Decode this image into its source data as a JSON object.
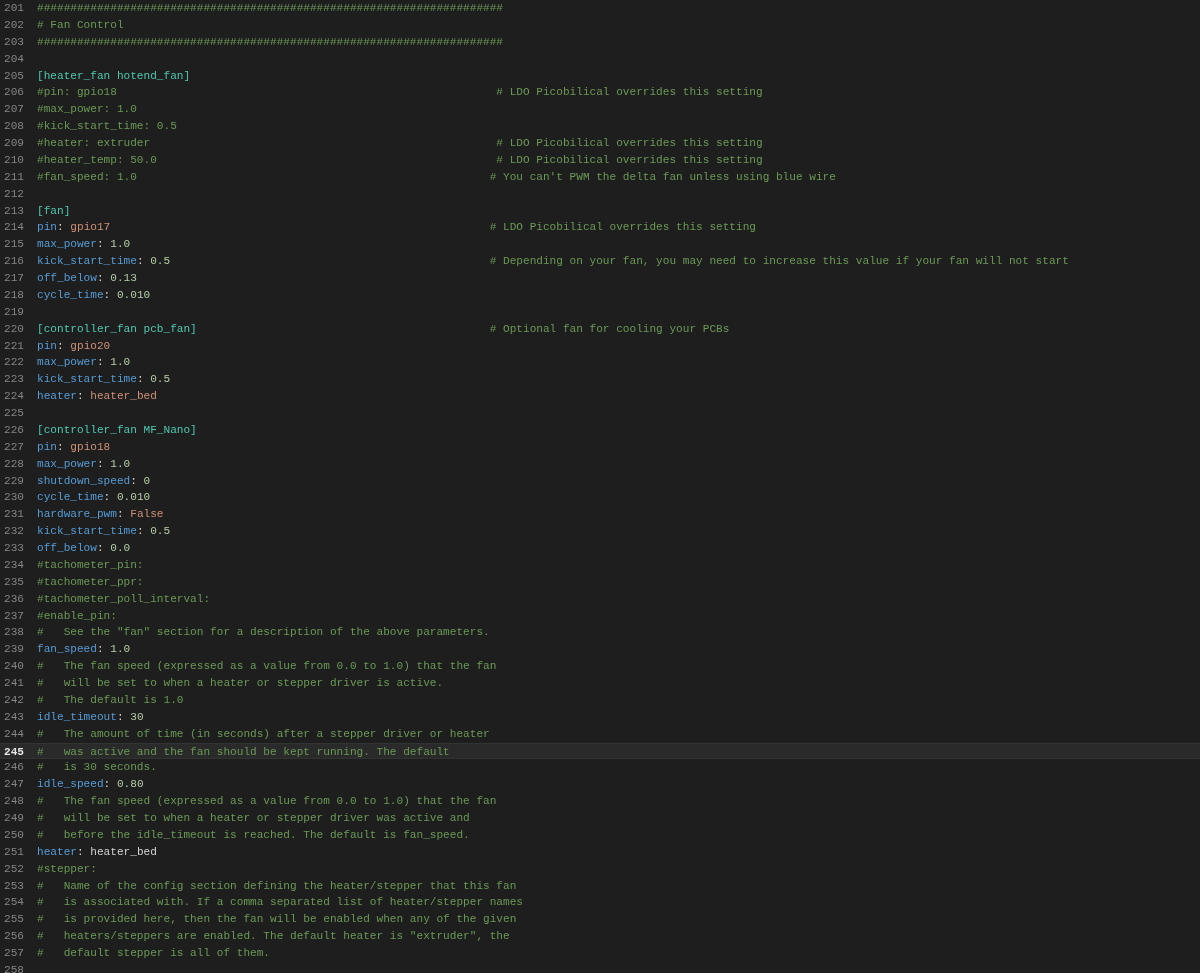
{
  "editor": {
    "lines": [
      {
        "number": "201",
        "current": false,
        "tokens": [
          {
            "kind": "comment",
            "text": "######################################################################"
          }
        ]
      },
      {
        "number": "202",
        "current": false,
        "tokens": [
          {
            "kind": "comment",
            "text": "# Fan Control"
          }
        ]
      },
      {
        "number": "203",
        "current": false,
        "tokens": [
          {
            "kind": "comment",
            "text": "######################################################################"
          }
        ]
      },
      {
        "number": "204",
        "current": false
      },
      {
        "number": "205",
        "current": false,
        "tokens": [
          {
            "kind": "section",
            "text": "[heater_fan hotend_fan]"
          }
        ]
      },
      {
        "number": "206",
        "current": false,
        "tokens": [
          {
            "kind": "comment",
            "text": "#pin: gpio18"
          },
          {
            "kind": "trailing_comment",
            "text": " # LDO Picobilical overrides this setting"
          }
        ]
      },
      {
        "number": "207",
        "current": false,
        "tokens": [
          {
            "kind": "comment",
            "text": "#max_power: 1.0"
          }
        ]
      },
      {
        "number": "208",
        "current": false,
        "tokens": [
          {
            "kind": "comment",
            "text": "#kick_start_time: 0.5"
          }
        ]
      },
      {
        "number": "209",
        "current": false,
        "tokens": [
          {
            "kind": "comment",
            "text": "#heater: extruder"
          },
          {
            "kind": "trailing_comment",
            "text": " # LDO Picobilical overrides this setting"
          }
        ]
      },
      {
        "number": "210",
        "current": false,
        "tokens": [
          {
            "kind": "comment",
            "text": "#heater_temp: 50.0"
          },
          {
            "kind": "trailing_comment",
            "text": " # LDO Picobilical overrides this setting"
          }
        ]
      },
      {
        "number": "211",
        "current": false,
        "tokens": [
          {
            "kind": "comment",
            "text": "#fan_speed: 1.0"
          },
          {
            "kind": "trailing_comment",
            "text": "# You can't PWM the delta fan unless using blue wire"
          }
        ]
      },
      {
        "number": "212",
        "current": false
      },
      {
        "number": "213",
        "current": false,
        "tokens": [
          {
            "kind": "section",
            "text": "[fan]"
          }
        ]
      },
      {
        "number": "214",
        "current": false,
        "tokens": [
          {
            "kind": "key",
            "text": "pin"
          },
          {
            "kind": "punct",
            "text": ": "
          },
          {
            "kind": "string",
            "text": "gpio17"
          },
          {
            "kind": "trailing_comment",
            "text": "# LDO Picobilical overrides this setting"
          }
        ]
      },
      {
        "number": "215",
        "current": false,
        "tokens": [
          {
            "kind": "key",
            "text": "max_power"
          },
          {
            "kind": "punct",
            "text": ": "
          },
          {
            "kind": "number",
            "text": "1.0"
          }
        ]
      },
      {
        "number": "216",
        "current": false,
        "tokens": [
          {
            "kind": "key",
            "text": "kick_start_time"
          },
          {
            "kind": "punct",
            "text": ": "
          },
          {
            "kind": "number",
            "text": "0.5"
          },
          {
            "kind": "trailing_comment",
            "text": "# Depending on your fan, you may need to increase this value if your fan will not start"
          }
        ]
      },
      {
        "number": "217",
        "current": false,
        "tokens": [
          {
            "kind": "key",
            "text": "off_below"
          },
          {
            "kind": "punct",
            "text": ": "
          },
          {
            "kind": "number",
            "text": "0.13"
          }
        ]
      },
      {
        "number": "218",
        "current": false,
        "tokens": [
          {
            "kind": "key",
            "text": "cycle_time"
          },
          {
            "kind": "punct",
            "text": ": "
          },
          {
            "kind": "number",
            "text": "0.010"
          }
        ]
      },
      {
        "number": "219",
        "current": false
      },
      {
        "number": "220",
        "current": false,
        "tokens": [
          {
            "kind": "section",
            "text": "[controller_fan pcb_fan]"
          },
          {
            "kind": "trailing_comment",
            "text": "# Optional fan for cooling your PCBs"
          }
        ]
      },
      {
        "number": "221",
        "current": false,
        "tokens": [
          {
            "kind": "key",
            "text": "pin"
          },
          {
            "kind": "punct",
            "text": ": "
          },
          {
            "kind": "string",
            "text": "gpio20"
          }
        ]
      },
      {
        "number": "222",
        "current": false,
        "tokens": [
          {
            "kind": "key",
            "text": "max_power"
          },
          {
            "kind": "punct",
            "text": ": "
          },
          {
            "kind": "number",
            "text": "1.0"
          }
        ]
      },
      {
        "number": "223",
        "current": false,
        "tokens": [
          {
            "kind": "key",
            "text": "kick_start_time"
          },
          {
            "kind": "punct",
            "text": ": "
          },
          {
            "kind": "number",
            "text": "0.5"
          }
        ]
      },
      {
        "number": "224",
        "current": false,
        "tokens": [
          {
            "kind": "key",
            "text": "heater"
          },
          {
            "kind": "punct",
            "text": ": "
          },
          {
            "kind": "string",
            "text": "heater_bed"
          }
        ]
      },
      {
        "number": "225",
        "current": false
      },
      {
        "number": "226",
        "current": false,
        "tokens": [
          {
            "kind": "section",
            "text": "[controller_fan MF_Nano]"
          }
        ]
      },
      {
        "number": "227",
        "current": false,
        "tokens": [
          {
            "kind": "key",
            "text": "pin"
          },
          {
            "kind": "punct",
            "text": ": "
          },
          {
            "kind": "string",
            "text": "gpio18"
          }
        ]
      },
      {
        "number": "228",
        "current": false,
        "tokens": [
          {
            "kind": "key",
            "text": "max_power"
          },
          {
            "kind": "punct",
            "text": ": "
          },
          {
            "kind": "number",
            "text": "1.0"
          }
        ]
      },
      {
        "number": "229",
        "current": false,
        "tokens": [
          {
            "kind": "key",
            "text": "shutdown_speed"
          },
          {
            "kind": "punct",
            "text": ": "
          },
          {
            "kind": "number",
            "text": "0"
          }
        ]
      },
      {
        "number": "230",
        "current": false,
        "tokens": [
          {
            "kind": "key",
            "text": "cycle_time"
          },
          {
            "kind": "punct",
            "text": ": "
          },
          {
            "kind": "number",
            "text": "0.010"
          }
        ]
      },
      {
        "number": "231",
        "current": false,
        "tokens": [
          {
            "kind": "key",
            "text": "hardware_pwm"
          },
          {
            "kind": "punct",
            "text": ": "
          },
          {
            "kind": "string",
            "text": "False"
          }
        ]
      },
      {
        "number": "232",
        "current": false,
        "tokens": [
          {
            "kind": "key",
            "text": "kick_start_time"
          },
          {
            "kind": "punct",
            "text": ": "
          },
          {
            "kind": "number",
            "text": "0.5"
          }
        ]
      },
      {
        "number": "233",
        "current": false,
        "tokens": [
          {
            "kind": "key",
            "text": "off_below"
          },
          {
            "kind": "punct",
            "text": ": "
          },
          {
            "kind": "number",
            "text": "0.0"
          }
        ]
      },
      {
        "number": "234",
        "current": false,
        "tokens": [
          {
            "kind": "comment",
            "text": "#tachometer_pin:"
          }
        ]
      },
      {
        "number": "235",
        "current": false,
        "tokens": [
          {
            "kind": "comment",
            "text": "#tachometer_ppr:"
          }
        ]
      },
      {
        "number": "236",
        "current": false,
        "tokens": [
          {
            "kind": "comment",
            "text": "#tachometer_poll_interval:"
          }
        ]
      },
      {
        "number": "237",
        "current": false,
        "tokens": [
          {
            "kind": "comment",
            "text": "#enable_pin:"
          }
        ]
      },
      {
        "number": "238",
        "current": false,
        "tokens": [
          {
            "kind": "comment",
            "text": "#   See the \"fan\" section for a description of the above parameters."
          }
        ]
      },
      {
        "number": "239",
        "current": false,
        "tokens": [
          {
            "kind": "key",
            "text": "fan_speed"
          },
          {
            "kind": "punct",
            "text": ": "
          },
          {
            "kind": "number",
            "text": "1.0"
          }
        ]
      },
      {
        "number": "240",
        "current": false,
        "tokens": [
          {
            "kind": "comment",
            "text": "#   The fan speed (expressed as a value from 0.0 to 1.0) that the fan"
          }
        ]
      },
      {
        "number": "241",
        "current": false,
        "tokens": [
          {
            "kind": "comment",
            "text": "#   will be set to when a heater or stepper driver is active."
          }
        ]
      },
      {
        "number": "242",
        "current": false,
        "tokens": [
          {
            "kind": "comment",
            "text": "#   The default is 1.0"
          }
        ]
      },
      {
        "number": "243",
        "current": false,
        "tokens": [
          {
            "kind": "key",
            "text": "idle_timeout"
          },
          {
            "kind": "punct",
            "text": ": "
          },
          {
            "kind": "number",
            "text": "30"
          }
        ]
      },
      {
        "number": "244",
        "current": false,
        "tokens": [
          {
            "kind": "comment",
            "text": "#   The amount of time (in seconds) after a stepper driver or heater"
          }
        ]
      },
      {
        "number": "245",
        "current": true,
        "tokens": [
          {
            "kind": "comment",
            "text": "#   was active and the fan should be kept running. The default"
          }
        ]
      },
      {
        "number": "246",
        "current": false,
        "tokens": [
          {
            "kind": "comment",
            "text": "#   is 30 seconds."
          }
        ]
      },
      {
        "number": "247",
        "current": false,
        "tokens": [
          {
            "kind": "key",
            "text": "idle_speed"
          },
          {
            "kind": "punct",
            "text": ": "
          },
          {
            "kind": "number",
            "text": "0.80"
          }
        ]
      },
      {
        "number": "248",
        "current": false,
        "tokens": [
          {
            "kind": "comment",
            "text": "#   The fan speed (expressed as a value from 0.0 to 1.0) that the fan"
          }
        ]
      },
      {
        "number": "249",
        "current": false,
        "tokens": [
          {
            "kind": "comment",
            "text": "#   will be set to when a heater or stepper driver was active and"
          }
        ]
      },
      {
        "number": "250",
        "current": false,
        "tokens": [
          {
            "kind": "comment",
            "text": "#   before the idle_timeout is reached. The default is fan_speed."
          }
        ]
      },
      {
        "number": "251",
        "current": false,
        "tokens": [
          {
            "kind": "key",
            "text": "heater"
          },
          {
            "kind": "punct",
            "text": ": "
          },
          {
            "kind": "plain",
            "text": "heater_bed"
          }
        ]
      },
      {
        "number": "252",
        "current": false,
        "tokens": [
          {
            "kind": "comment",
            "text": "#stepper:"
          }
        ]
      },
      {
        "number": "253",
        "current": false,
        "tokens": [
          {
            "kind": "comment",
            "text": "#   Name of the config section defining the heater/stepper that this fan"
          }
        ]
      },
      {
        "number": "254",
        "current": false,
        "tokens": [
          {
            "kind": "comment",
            "text": "#   is associated with. If a comma separated list of heater/stepper names"
          }
        ]
      },
      {
        "number": "255",
        "current": false,
        "tokens": [
          {
            "kind": "comment",
            "text": "#   is provided here, then the fan will be enabled when any of the given"
          }
        ]
      },
      {
        "number": "256",
        "current": false,
        "tokens": [
          {
            "kind": "comment",
            "text": "#   heaters/steppers are enabled. The default heater is \"extruder\", the"
          }
        ]
      },
      {
        "number": "257",
        "current": false,
        "tokens": [
          {
            "kind": "comment",
            "text": "#   default stepper is all of them."
          }
        ]
      },
      {
        "number": "258",
        "current": false
      }
    ]
  }
}
